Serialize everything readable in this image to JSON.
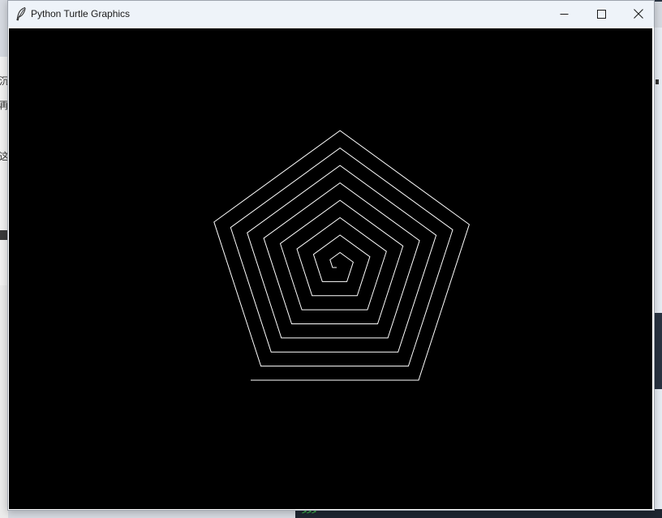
{
  "window": {
    "title": "Python Turtle Graphics",
    "controls": {
      "minimize": "minimize-icon",
      "maximize": "maximize-icon",
      "close": "close-icon"
    },
    "app_icon": "feather-icon"
  },
  "canvas": {
    "background_color": "#000000",
    "pen_color": "#ffffff",
    "drawing": "pentagon spiral"
  },
  "background_apps": {
    "left_glyphs": [
      "沉",
      "再",
      "这"
    ],
    "console_prompt": ">>>"
  }
}
